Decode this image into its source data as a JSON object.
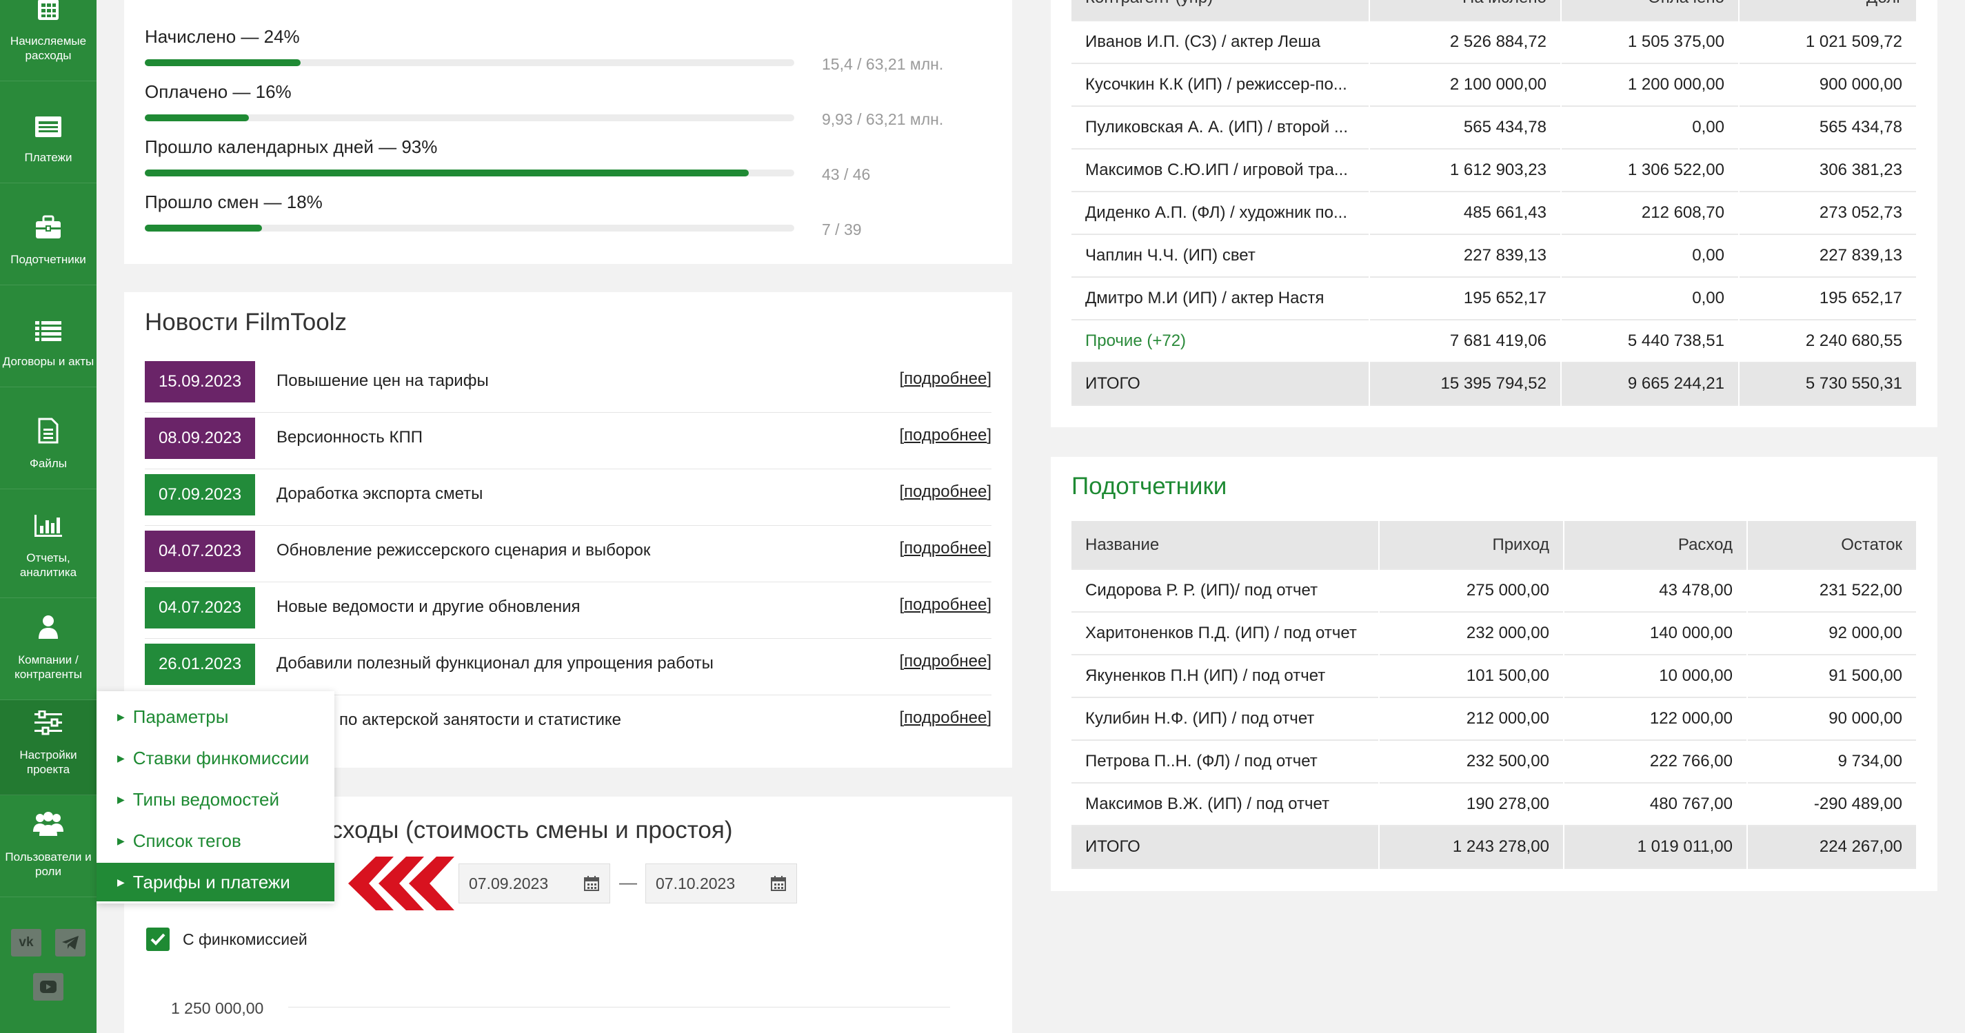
{
  "sidebar": {
    "items": [
      {
        "label": "Начисляемые расходы",
        "icon": "calculator-icon"
      },
      {
        "label": "Платежи",
        "icon": "payments-icon"
      },
      {
        "label": "Подотчетники",
        "icon": "briefcase-icon"
      },
      {
        "label": "Договоры и акты",
        "icon": "list-icon"
      },
      {
        "label": "Файлы",
        "icon": "file-icon"
      },
      {
        "label": "Отчеты, аналитика",
        "icon": "bar-chart-icon"
      },
      {
        "label": "Компании / контрагенты",
        "icon": "user-icon"
      },
      {
        "label": "Настройки проекта",
        "icon": "sliders-icon"
      },
      {
        "label": "Пользователи и роли",
        "icon": "users-icon"
      }
    ],
    "social": [
      "vk-icon",
      "telegram-icon",
      "youtube-icon"
    ]
  },
  "progress": [
    {
      "label": "Начислено — 24%",
      "value": "15,4 / 63,21 млн.",
      "percent": 24
    },
    {
      "label": "Оплачено — 16%",
      "value": "9,93 / 63,21 млн.",
      "percent": 16
    },
    {
      "label": "Прошло календарных дней — 93%",
      "value": "43 / 46",
      "percent": 93
    },
    {
      "label": "Прошло смен — 18%",
      "value": "7 / 39",
      "percent": 18
    }
  ],
  "news": {
    "title": "Новости FilmToolz",
    "more_label": "подробнее",
    "items": [
      {
        "date": "15.09.2023",
        "color": "purple",
        "text": "Повышение цен на тарифы"
      },
      {
        "date": "08.09.2023",
        "color": "purple",
        "text": "Версионность КПП"
      },
      {
        "date": "07.09.2023",
        "color": "green",
        "text": "Доработка экспорта сметы"
      },
      {
        "date": "04.07.2023",
        "color": "purple",
        "text": "Обновление режиссерского сценария и выборок"
      },
      {
        "date": "04.07.2023",
        "color": "green",
        "text": "Новые ведомости и другие обновления"
      },
      {
        "date": "26.01.2023",
        "color": "green",
        "text": "Добавили полезный функционал для упрощения работы"
      },
      {
        "date": "",
        "color": "green",
        "text": "по актерской занятости и статистике"
      }
    ]
  },
  "settings_menu": {
    "items": [
      "Параметры",
      "Ставки финкомиссии",
      "Типы ведомостей",
      "Список тегов",
      "Тарифы и платежи"
    ],
    "active_index": 4
  },
  "costs": {
    "title_visible": "асходы (стоимость смены и простоя)",
    "date_from": "07.09.2023",
    "date_to": "07.10.2023",
    "date_separator": "—",
    "checkbox_label": "С финкомиссией",
    "checkbox_checked": true,
    "y_tick": "1 250 000,00"
  },
  "contractors": {
    "header_partial": [
      "Контрагент (упр)",
      "Начислено",
      "Оплачено",
      "Долг"
    ],
    "rows": [
      {
        "name": "Иванов И.П. (СЗ) / актер Леша",
        "c1": "2 526 884,72",
        "c2": "1 505 375,00",
        "c3": "1 021 509,72"
      },
      {
        "name": "Кусочкин К.К (ИП) / режиссер-по...",
        "c1": "2 100 000,00",
        "c2": "1 200 000,00",
        "c3": "900 000,00"
      },
      {
        "name": "Пуликовская А. А. (ИП) / второй ...",
        "c1": "565 434,78",
        "c2": "0,00",
        "c3": "565 434,78"
      },
      {
        "name": "Максимов С.Ю.ИП / игровой тра...",
        "c1": "1 612 903,23",
        "c2": "1 306 522,00",
        "c3": "306 381,23"
      },
      {
        "name": "Диденко А.П. (ФЛ) / художник по...",
        "c1": "485 661,43",
        "c2": "212 608,70",
        "c3": "273 052,73"
      },
      {
        "name": "Чаплин Ч.Ч. (ИП) свет",
        "c1": "227 839,13",
        "c2": "0,00",
        "c3": "227 839,13"
      },
      {
        "name": "Дмитро М.И (ИП) / актер Настя",
        "c1": "195 652,17",
        "c2": "0,00",
        "c3": "195 652,17"
      },
      {
        "name": "Прочие (+72)",
        "c1": "7 681 419,06",
        "c2": "5 440 738,51",
        "c3": "2 240 680,55",
        "link": true
      }
    ],
    "total": {
      "name": "ИТОГО",
      "c1": "15 395 794,52",
      "c2": "9 665 244,21",
      "c3": "5 730 550,31"
    }
  },
  "accountables": {
    "title": "Подотчетники",
    "headers": [
      "Название",
      "Приход",
      "Расход",
      "Остаток"
    ],
    "rows": [
      {
        "name": "Сидорова Р. Р. (ИП)/ под отчет",
        "c1": "275 000,00",
        "c2": "43 478,00",
        "c3": "231 522,00"
      },
      {
        "name": "Харитоненков П.Д. (ИП) / под отчет",
        "c1": "232 000,00",
        "c2": "140 000,00",
        "c3": "92 000,00"
      },
      {
        "name": "Якуненков П.Н (ИП) / под отчет",
        "c1": "101 500,00",
        "c2": "10 000,00",
        "c3": "91 500,00"
      },
      {
        "name": "Кулибин Н.Ф. (ИП) / под отчет",
        "c1": "212 000,00",
        "c2": "122 000,00",
        "c3": "90 000,00"
      },
      {
        "name": "Петрова П..Н. (ФЛ) / под отчет",
        "c1": "232 500,00",
        "c2": "222 766,00",
        "c3": "9 734,00"
      },
      {
        "name": "Максимов В.Ж. (ИП) / под отчет",
        "c1": "190 278,00",
        "c2": "480 767,00",
        "c3": "-290 489,00"
      }
    ],
    "total": {
      "name": "ИТОГО",
      "c1": "1 243 278,00",
      "c2": "1 019 011,00",
      "c3": "224 267,00"
    }
  },
  "colors": {
    "brand_green": "#2a8a3a",
    "news_purple": "#6a2468",
    "arrow_red": "#d8121f"
  }
}
